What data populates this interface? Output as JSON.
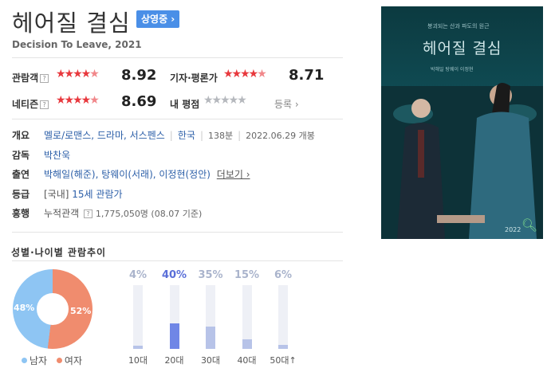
{
  "movie": {
    "title": "헤어질 결심",
    "status_badge": "상영중 ›",
    "subtitle": "Decision To Leave, 2021"
  },
  "ratings": {
    "audience": {
      "label": "관람객",
      "help": "?",
      "score": "8.92",
      "stars_on": 4.5
    },
    "critic": {
      "label": "기자·평론가",
      "score": "8.71",
      "stars_on": 4.5
    },
    "netizen": {
      "label": "네티즌",
      "help": "?",
      "score": "8.69",
      "stars_on": 4.5
    },
    "mine": {
      "label": "내 평점",
      "enroll": "등록 ›",
      "stars_on": 0
    }
  },
  "info": {
    "overview": {
      "label": "개요",
      "genre": "멜로/로맨스, 드라마, 서스펜스",
      "country": "한국",
      "runtime": "138분",
      "release": "2022.06.29 개봉"
    },
    "director": {
      "label": "감독",
      "name": "박찬욱"
    },
    "cast": {
      "label": "출연",
      "names": "박해일(해준), 탕웨이(서래), 이정현(정안)",
      "more": "더보기 ›"
    },
    "grade": {
      "label": "등급",
      "region": "[국내]",
      "value": "15세 관람가"
    },
    "box": {
      "label": "흥행",
      "text": "누적관객",
      "help": "?",
      "value": "1,775,050명 (08.07 기준)"
    }
  },
  "poster": {
    "title": "헤어질 결심",
    "tagline": "붕괴되는 산과 파도의 원근",
    "cast": "박해일  탕웨이  이정현",
    "year": "2022"
  },
  "trend": {
    "title": "성별·나이별 관람추이",
    "gender": {
      "male_label": "남자",
      "male_pct": 48,
      "male_text": "48%",
      "male_color": "#8ec5f3",
      "female_label": "여자",
      "female_pct": 52,
      "female_text": "52%",
      "female_color": "#f08c6e"
    },
    "ages": [
      {
        "label": "10대",
        "pct": 4,
        "text": "4%"
      },
      {
        "label": "20대",
        "pct": 40,
        "text": "40%"
      },
      {
        "label": "30대",
        "pct": 35,
        "text": "35%"
      },
      {
        "label": "40대",
        "pct": 15,
        "text": "15%"
      },
      {
        "label": "50대↑",
        "pct": 6,
        "text": "6%"
      }
    ]
  }
}
